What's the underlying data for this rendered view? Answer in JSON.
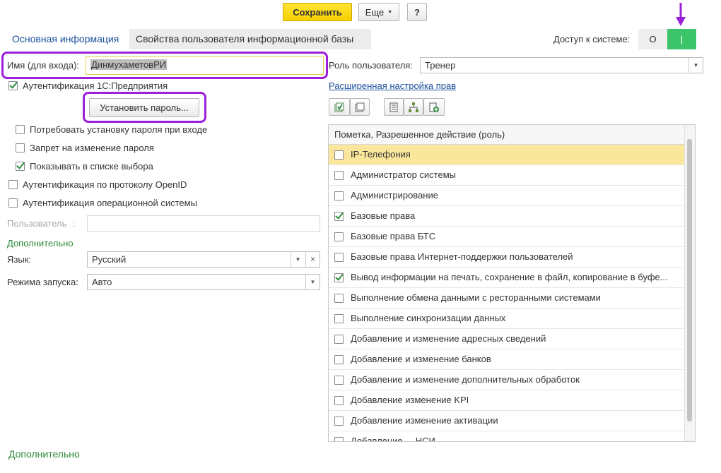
{
  "toolbar": {
    "save_label": "Сохранить",
    "more_label": "Еще",
    "help_label": "?"
  },
  "tabs": {
    "main_info": "Основная информация",
    "db_user_props": "Свойства пользователя информационной базы"
  },
  "access": {
    "label": "Доступ к системе:",
    "off_label": "О",
    "on_label": "|"
  },
  "form": {
    "login_label": "Имя (для входа):",
    "login_value": "ДинмухаметовРИ",
    "auth_1c_label": "Аутентификация 1С:Предприятия",
    "set_password_label": "Установить пароль...",
    "require_password_change": "Потребовать установку пароля при входе",
    "forbid_password_change": "Запрет на изменение пароля",
    "show_in_list": "Показывать в списке выбора",
    "openid_auth": "Аутентификация по протоколу OpenID",
    "os_auth": "Аутентификация операционной системы",
    "user_label": "Пользователь",
    "user_sep": ":",
    "additional_header": "Дополнительно",
    "language_label": "Язык:",
    "language_value": "Русский",
    "launch_mode_label": "Режима запуска:",
    "launch_mode_value": "Авто",
    "footer_additional": "Дополнительно"
  },
  "role": {
    "label": "Роль пользователя:",
    "value": "Тренер",
    "advanced_link": "Расширенная настройка прав"
  },
  "roles_table": {
    "header": "Пометка, Разрешенное действие (роль)",
    "rows": [
      {
        "label": "IP-Телефония",
        "checked": false,
        "selected": true
      },
      {
        "label": "Администратор системы",
        "checked": false
      },
      {
        "label": "Администрирование",
        "checked": false
      },
      {
        "label": "Базовые права",
        "checked": true
      },
      {
        "label": "Базовые права БТС",
        "checked": false
      },
      {
        "label": "Базовые права Интернет-поддержки пользователей",
        "checked": false
      },
      {
        "label": "Вывод информации на печать, сохранение в файл, копирование в буфе...",
        "checked": true
      },
      {
        "label": "Выполнение обмена данными с ресторанными системами",
        "checked": false
      },
      {
        "label": "Выполнение синхронизации данных",
        "checked": false
      },
      {
        "label": "Добавление и изменение адресных сведений",
        "checked": false
      },
      {
        "label": "Добавление и изменение банков",
        "checked": false
      },
      {
        "label": "Добавление и изменение дополнительных обработок",
        "checked": false
      },
      {
        "label": "Добавление изменение KPI",
        "checked": false
      },
      {
        "label": "Добавление изменение активации",
        "checked": false
      },
      {
        "label": "Добавление ... НСИ",
        "checked": false
      }
    ]
  },
  "colors": {
    "accent_purple": "#9b1fdb",
    "save_yellow": "#f5cf00",
    "toggle_green": "#3cc46a",
    "selected_row": "#fbe79c",
    "link_blue": "#1a4f9c",
    "section_green": "#2c8a39"
  }
}
